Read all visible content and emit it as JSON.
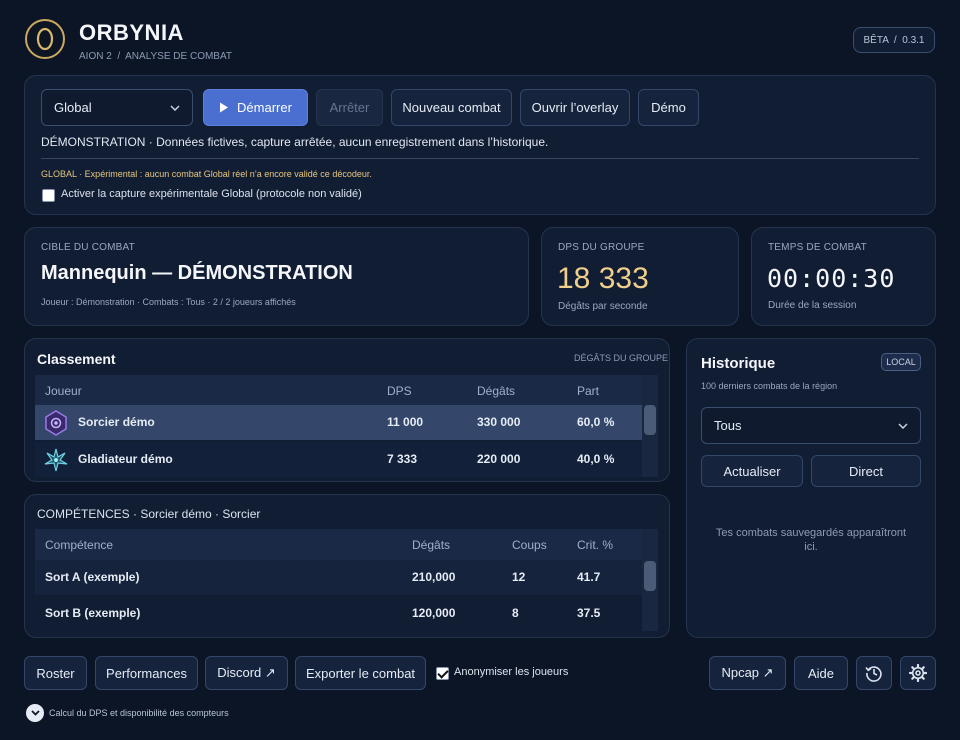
{
  "app": {
    "name": "ORBYNIA",
    "breadcrumb": "AION 2  /  ANALYSE DE COMBAT",
    "version": "BÊTA  /  0.3.1"
  },
  "controls": {
    "mode_select": "Global",
    "start": "Démarrer",
    "stop": "Arrêter",
    "new_combat": "Nouveau combat",
    "open_overlay": "Ouvrir l’overlay",
    "demo": "Démo",
    "status_text": "DÉMONSTRATION · Données fictives, capture arrêtée, aucun enregistrement dans l’historique.",
    "warning_text": "GLOBAL · Expérimental : aucun combat Global réel n’a encore validé ce décodeur.",
    "global_capture_label": "Activer la capture expérimentale Global (protocole non validé)",
    "global_capture_checked": false
  },
  "target": {
    "label": "CIBLE DU COMBAT",
    "name": "Mannequin — DÉMONSTRATION",
    "details": "Joueur : Démonstration · Combats : Tous · 2 / 2 joueurs affichés"
  },
  "group_dps": {
    "label": "DPS DU GROUPE",
    "value": "18 333",
    "sub": "Dégâts par seconde",
    "color": "#f0cf8c"
  },
  "combat_time": {
    "label": "TEMPS DE COMBAT",
    "value": "00:00:30",
    "sub": "Durée de la session"
  },
  "ranking": {
    "title": "Classement",
    "tag": "DÉGÂTS DU GROUPE",
    "headers": [
      "Joueur",
      "DPS",
      "Dégâts",
      "Part"
    ],
    "rows": [
      {
        "icon": "sorcerer-class-icon",
        "player": "Sorcier démo",
        "dps": "11 000",
        "damage": "330 000",
        "share": "60,0 %"
      },
      {
        "icon": "gladiator-class-icon",
        "player": "Gladiateur démo",
        "dps": "7 333",
        "damage": "220 000",
        "share": "40,0 %"
      }
    ]
  },
  "skills": {
    "title": "COMPÉTENCES · Sorcier démo · Sorcier",
    "headers": [
      "Compétence",
      "Dégâts",
      "Coups",
      "Crit. %"
    ],
    "rows": [
      {
        "skill": "Sort A (exemple)",
        "damage": "210,000",
        "hits": "12",
        "crit": "41.7"
      },
      {
        "skill": "Sort B (exemple)",
        "damage": "120,000",
        "hits": "8",
        "crit": "37.5"
      }
    ]
  },
  "history": {
    "title": "Historique",
    "badge": "LOCAL",
    "subtitle": "100 derniers combats de la région",
    "filter": "Tous",
    "refresh": "Actualiser",
    "live": "Direct",
    "empty": "Tes combats sauvegardés apparaîtront ici."
  },
  "footer": {
    "roster": "Roster",
    "performance": "Performances",
    "discord": "Discord ↗",
    "export": "Exporter le combat",
    "anonymize": "Anonymiser les joueurs",
    "anonymize_checked": true,
    "npcap": "Npcap ↗",
    "help": "Aide",
    "note": "Calcul du DPS et disponibilité des compteurs"
  }
}
